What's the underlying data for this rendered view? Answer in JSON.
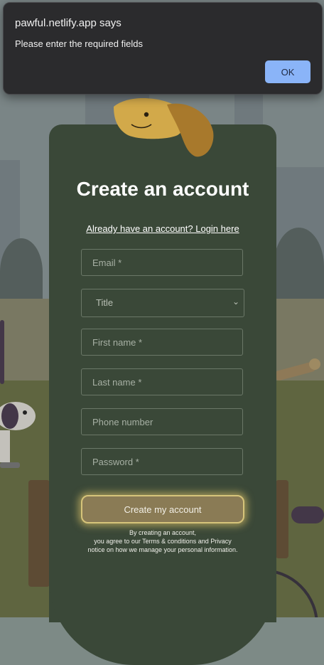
{
  "dialog": {
    "title": "pawful.netlify.app says",
    "message": "Please enter the required fields",
    "ok_label": "OK"
  },
  "form": {
    "title": "Create an account",
    "login_link": "Already have an account? Login here",
    "email_placeholder": "Email *",
    "title_select": "Title",
    "first_name_placeholder": "First name *",
    "last_name_placeholder": "Last name *",
    "phone_placeholder": "Phone number",
    "password_placeholder": "Password *",
    "submit_label": "Create my account",
    "legal": [
      "By creating an account,",
      "you agree to our Terms & conditions and Privacy",
      "notice on how we manage your personal information."
    ]
  },
  "colors": {
    "card": "#3a4838",
    "accent_button": "#8ab4f8",
    "submit_glow": "#d6c47a"
  }
}
